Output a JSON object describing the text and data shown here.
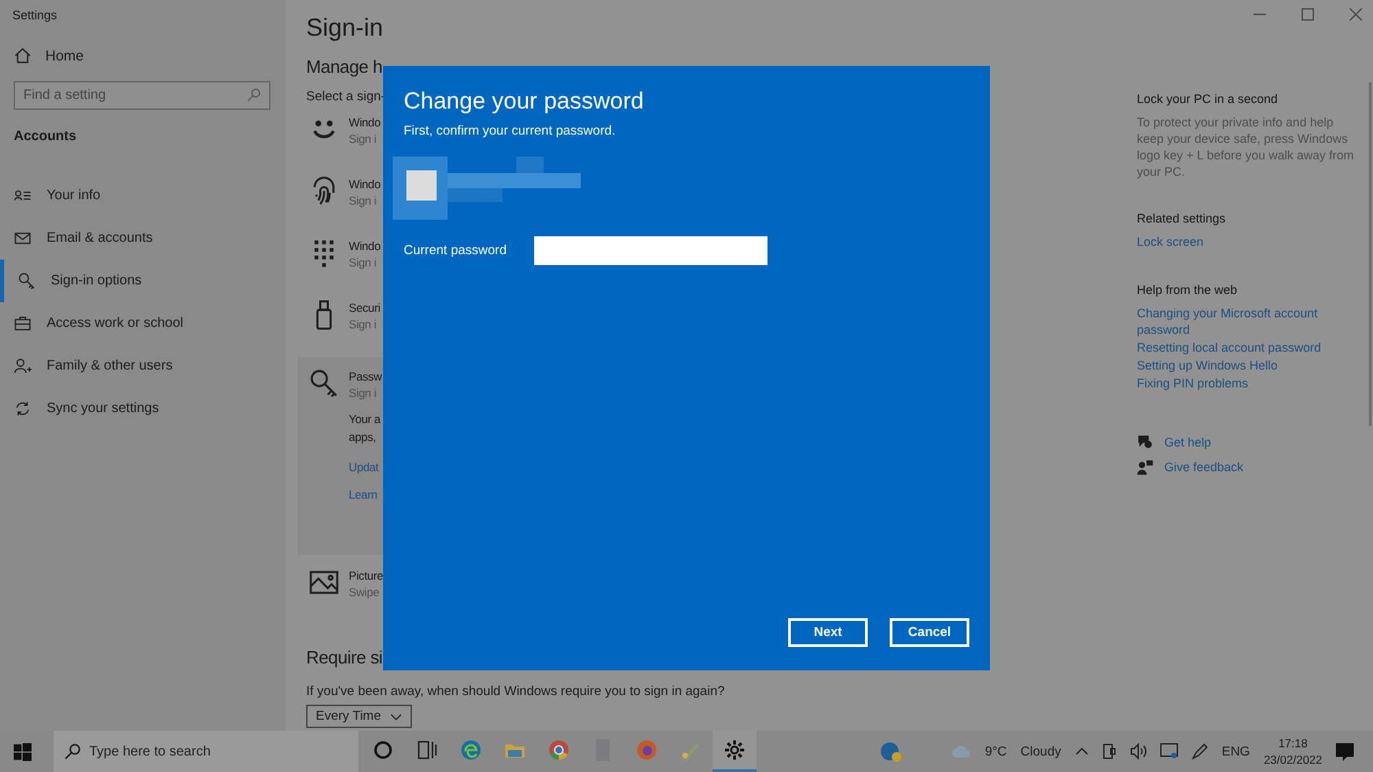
{
  "window": {
    "title": "Settings"
  },
  "sidebar": {
    "home": "Home",
    "search": {
      "placeholder": "Find a setting"
    },
    "section": "Accounts",
    "items": [
      {
        "label": "Your info",
        "kind": "person-list",
        "selected": false
      },
      {
        "label": "Email & accounts",
        "kind": "mail",
        "selected": false
      },
      {
        "label": "Sign-in options",
        "kind": "key",
        "selected": true
      },
      {
        "label": "Access work or school",
        "kind": "briefcase",
        "selected": false
      },
      {
        "label": "Family & other users",
        "kind": "person-plus",
        "selected": false
      },
      {
        "label": "Sync your settings",
        "kind": "sync",
        "selected": false
      }
    ]
  },
  "main": {
    "heading": "Sign-in",
    "subheading": "Manage h",
    "prompt": "Select a sign-",
    "options": [
      {
        "kind": "smile",
        "title": "Windo",
        "subtitle": "Sign i",
        "expanded": false
      },
      {
        "kind": "fingerprint",
        "title": "Windo",
        "subtitle": "Sign i",
        "expanded": false
      },
      {
        "kind": "keypad",
        "title": "Windo",
        "subtitle": "Sign i",
        "expanded": false
      },
      {
        "kind": "usb",
        "title": "Securi",
        "subtitle": "Sign i",
        "expanded": false
      },
      {
        "kind": "key",
        "title": "Passw",
        "subtitle": "Sign i",
        "expanded": true,
        "details": [
          "Your a",
          "apps,"
        ],
        "links": [
          "Updat",
          "Learn"
        ]
      },
      {
        "kind": "picture",
        "title": "Picture",
        "subtitle": "Swipe",
        "expanded": false
      }
    ],
    "require": {
      "heading": "Require si",
      "text": "If you've been away, when should Windows require you to sign in again?",
      "dropdown": "Every Time"
    }
  },
  "right_panel": {
    "sections": [
      {
        "heading": "Lock your PC in a second",
        "text": "To protect your private info and help keep your device safe, press Windows logo key + L before you walk away from your PC."
      },
      {
        "heading": "Related settings",
        "links": [
          "Lock screen"
        ]
      },
      {
        "heading": "Help from the web",
        "links": [
          "Changing your Microsoft account password",
          "Resetting local account password",
          "Setting up Windows Hello",
          "Fixing PIN problems"
        ]
      }
    ],
    "actions": [
      {
        "kind": "chat",
        "label": "Get help"
      },
      {
        "kind": "feedback",
        "label": "Give feedback"
      }
    ]
  },
  "dialog": {
    "title": "Change your password",
    "subtitle": "First, confirm your current password.",
    "field": {
      "label": "Current password"
    },
    "buttons": [
      "Next",
      "Cancel"
    ]
  },
  "taskbar": {
    "search": {
      "placeholder": "Type here to search"
    },
    "apps": [
      {
        "kind": "cortana",
        "active": false
      },
      {
        "kind": "taskview",
        "active": false
      },
      {
        "kind": "edge",
        "active": false
      },
      {
        "kind": "folder",
        "active": false
      },
      {
        "kind": "chrome",
        "active": false
      },
      {
        "kind": "blank",
        "active": false
      },
      {
        "kind": "firefox",
        "active": false
      },
      {
        "kind": "paint",
        "active": false
      },
      {
        "kind": "gear",
        "active": true
      }
    ],
    "weather": "9°C",
    "condition": "Cloudy",
    "language": "ENG",
    "time": "17:18",
    "date": "23/02/2022"
  }
}
